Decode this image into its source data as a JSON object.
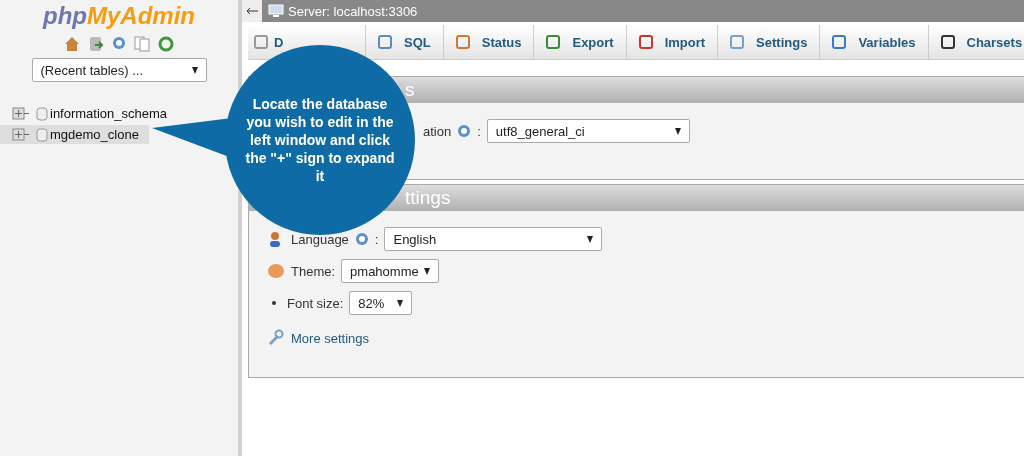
{
  "sidebar": {
    "logo": {
      "php": "php",
      "rest": "MyAdmin"
    },
    "recent_tables": "(Recent tables) ...",
    "databases": [
      {
        "name": "information_schema",
        "selected": false
      },
      {
        "name": "mgdemo_clone",
        "selected": true
      }
    ]
  },
  "breadcrumb": {
    "server": "Server: localhost:3306"
  },
  "tabs": [
    {
      "label": "D"
    },
    {
      "label": "SQL"
    },
    {
      "label": "Status"
    },
    {
      "label": "Export"
    },
    {
      "label": "Import"
    },
    {
      "label": "Settings"
    },
    {
      "label": "Variables"
    },
    {
      "label": "Charsets"
    }
  ],
  "general_settings": {
    "title": "s",
    "collation_label": "ation",
    "collation_separator": ":",
    "collation_value": "utf8_general_ci"
  },
  "appearance_settings": {
    "title": "ttings",
    "language_label": "Language",
    "language_separator": ":",
    "language_value": "English",
    "theme_label": "Theme:",
    "theme_value": "pmahomme",
    "font_size_label": "Font size:",
    "font_size_value": "82%",
    "more_settings": "More settings"
  },
  "callout": {
    "text": "Locate the database you wish to edit in the left window and click the \"+\" sign to expand it"
  }
}
